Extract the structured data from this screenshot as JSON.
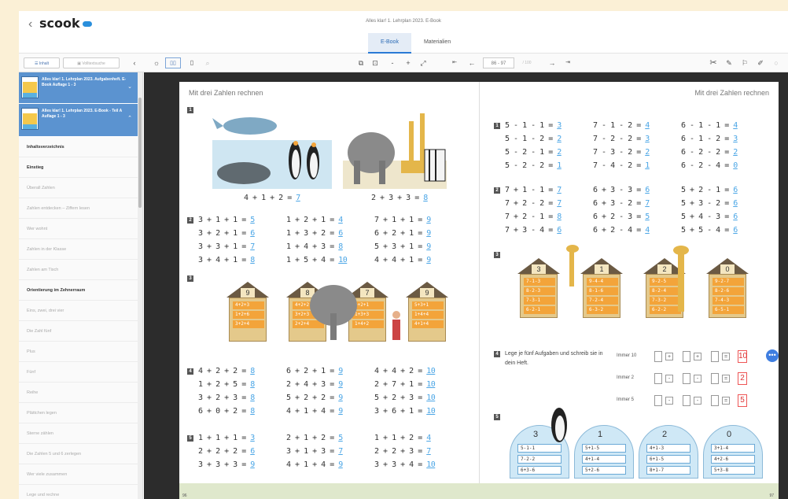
{
  "header": {
    "back_glyph": "‹",
    "logo": "scook",
    "doc_title": "Alles klar! 1. Lehrplan 2023. E-Book",
    "tabs": [
      {
        "label": "E-Book",
        "active": true
      },
      {
        "label": "Materialien",
        "active": false
      }
    ]
  },
  "toolbar": {
    "inhalt_label": "Inhalt",
    "search_label": "Volltextsuche",
    "collapse_glyph": "‹",
    "page_range": "86 - 97",
    "page_total": "/ 100",
    "zoom_minus": "-",
    "zoom_plus": "+",
    "icons": [
      "idea-icon",
      "double-page-icon",
      "single-page-icon",
      "search-icon",
      "gallery-icon",
      "fit-icon",
      "expand-icon",
      "first-page-icon",
      "prev-page-icon",
      "next-page-icon",
      "last-page-icon",
      "tools-icon",
      "notes-icon",
      "bookmark-icon",
      "pen-icon"
    ]
  },
  "sidebar": {
    "books": [
      {
        "text": "Alles klar! 1. Lehrplan 2023. Aufgabenheft. E-Book Auflage 1 - 3"
      },
      {
        "text": "Alles klar! 1. Lehrplan 2023. E-Book - Teil A Auflage 1 - 3"
      }
    ],
    "items": [
      {
        "label": "Inhaltsverzeichnis",
        "head": true
      },
      {
        "label": "Einstieg",
        "head": true
      },
      {
        "label": "Überall Zahlen",
        "head": false
      },
      {
        "label": "Zahlen entdecken – Ziffern lesen",
        "head": false
      },
      {
        "label": "Wer wohnt",
        "head": false
      },
      {
        "label": "Zahlen in der Klasse",
        "head": false
      },
      {
        "label": "Zahlen am Tisch",
        "head": false
      },
      {
        "label": "Orientierung im Zehnerraum",
        "head": true
      },
      {
        "label": "Eins, zwei, drei vier",
        "head": false
      },
      {
        "label": "Die Zahl fünf",
        "head": false
      },
      {
        "label": "Plus",
        "head": false
      },
      {
        "label": "Fünf",
        "head": false
      },
      {
        "label": "Reihe",
        "head": false
      },
      {
        "label": "Plättchen legen",
        "head": false
      },
      {
        "label": "Sterne zählen",
        "head": false
      },
      {
        "label": "Die Zahlen 5 und 6 zerlegen",
        "head": false
      },
      {
        "label": "Wer viele zusammen",
        "head": false
      },
      {
        "label": "Lege und rechne",
        "head": false
      }
    ]
  },
  "page_left": {
    "title": "Mit drei Zahlen rechnen",
    "page_no": "96",
    "task1": [
      {
        "eq": "4 + 1 + 2 = ",
        "ans": "7"
      },
      {
        "eq": "2 + 3 + 3 = ",
        "ans": "8"
      }
    ],
    "task2": [
      [
        {
          "eq": "3 + 1 + 1 = ",
          "ans": "5"
        },
        {
          "eq": "1 + 2 + 1 = ",
          "ans": "4"
        },
        {
          "eq": "7 + 1 + 1 = ",
          "ans": "9"
        }
      ],
      [
        {
          "eq": "3 + 2 + 1 = ",
          "ans": "6"
        },
        {
          "eq": "1 + 3 + 2 = ",
          "ans": "6"
        },
        {
          "eq": "6 + 2 + 1 = ",
          "ans": "9"
        }
      ],
      [
        {
          "eq": "3 + 3 + 1 = ",
          "ans": "7"
        },
        {
          "eq": "1 + 4 + 3 = ",
          "ans": "8"
        },
        {
          "eq": "5 + 3 + 1 = ",
          "ans": "9"
        }
      ],
      [
        {
          "eq": "3 + 4 + 1 = ",
          "ans": "8"
        },
        {
          "eq": "1 + 5 + 4 = ",
          "ans": "10"
        },
        {
          "eq": "4 + 4 + 1 = ",
          "ans": "9"
        }
      ]
    ],
    "houses": [
      {
        "num": "9",
        "rows": [
          "4+2+3",
          "1+2+6",
          "3+2+4"
        ]
      },
      {
        "num": "8",
        "rows": [
          "4+2+2",
          "3+2+3",
          "2+2+4"
        ]
      },
      {
        "num": "7",
        "rows": [
          "4+2+1",
          "1+3+3",
          "1+4+2"
        ]
      },
      {
        "num": "9",
        "rows": [
          "5+3+1",
          "1+4+4",
          "4+1+4"
        ]
      }
    ],
    "task4": [
      [
        {
          "eq": "4 + 2 + 2 = ",
          "ans": "8"
        },
        {
          "eq": "6 + 2 + 1 = ",
          "ans": "9"
        },
        {
          "eq": "4 + 4 + 2 = ",
          "ans": "10"
        }
      ],
      [
        {
          "eq": "1 + 2 + 5 = ",
          "ans": "8"
        },
        {
          "eq": "2 + 4 + 3 = ",
          "ans": "9"
        },
        {
          "eq": "2 + 7 + 1 = ",
          "ans": "10"
        }
      ],
      [
        {
          "eq": "3 + 2 + 3 = ",
          "ans": "8"
        },
        {
          "eq": "5 + 2 + 2 = ",
          "ans": "9"
        },
        {
          "eq": "5 + 2 + 3 = ",
          "ans": "10"
        }
      ],
      [
        {
          "eq": "6 + 0 + 2 = ",
          "ans": "8"
        },
        {
          "eq": "4 + 1 + 4 = ",
          "ans": "9"
        },
        {
          "eq": "3 + 6 + 1 = ",
          "ans": "10"
        }
      ]
    ],
    "task5": [
      [
        {
          "eq": "1 + 1 + 1 = ",
          "ans": "3"
        },
        {
          "eq": "2 + 1 + 2 = ",
          "ans": "5"
        },
        {
          "eq": "1 + 1 + 2 = ",
          "ans": "4"
        }
      ],
      [
        {
          "eq": "2 + 2 + 2 = ",
          "ans": "6"
        },
        {
          "eq": "3 + 1 + 3 = ",
          "ans": "7"
        },
        {
          "eq": "2 + 2 + 3 = ",
          "ans": "7"
        }
      ],
      [
        {
          "eq": "3 + 3 + 3 = ",
          "ans": "9"
        },
        {
          "eq": "4 + 1 + 4 = ",
          "ans": "9"
        },
        {
          "eq": "3 + 3 + 4 = ",
          "ans": "10"
        }
      ]
    ]
  },
  "page_right": {
    "title": "Mit drei Zahlen rechnen",
    "page_no": "97",
    "task1": [
      [
        {
          "eq": "5 - 1 - 1 = ",
          "ans": "3"
        },
        {
          "eq": "7 - 1 - 2 = ",
          "ans": "4"
        },
        {
          "eq": "6 - 1 - 1 = ",
          "ans": "4"
        }
      ],
      [
        {
          "eq": "5 - 1 - 2 = ",
          "ans": "2"
        },
        {
          "eq": "7 - 2 - 2 = ",
          "ans": "3"
        },
        {
          "eq": "6 - 1 - 2 = ",
          "ans": "3"
        }
      ],
      [
        {
          "eq": "5 - 2 - 1 = ",
          "ans": "2"
        },
        {
          "eq": "7 - 3 - 2 = ",
          "ans": "2"
        },
        {
          "eq": "6 - 2 - 2 = ",
          "ans": "2"
        }
      ],
      [
        {
          "eq": "5 - 2 - 2 = ",
          "ans": "1"
        },
        {
          "eq": "7 - 4 - 2 = ",
          "ans": "1"
        },
        {
          "eq": "6 - 2 - 4 = ",
          "ans": "0"
        }
      ]
    ],
    "task2": [
      [
        {
          "eq": "7 + 1 - 1 = ",
          "ans": "7"
        },
        {
          "eq": "6 + 3 - 3 = ",
          "ans": "6"
        },
        {
          "eq": "5 + 2 - 1 = ",
          "ans": "6"
        }
      ],
      [
        {
          "eq": "7 + 2 - 2 = ",
          "ans": "7"
        },
        {
          "eq": "6 + 3 - 2 = ",
          "ans": "7"
        },
        {
          "eq": "5 + 3 - 2 = ",
          "ans": "6"
        }
      ],
      [
        {
          "eq": "7 + 2 - 1 = ",
          "ans": "8"
        },
        {
          "eq": "6 + 2 - 3 = ",
          "ans": "5"
        },
        {
          "eq": "5 + 4 - 3 = ",
          "ans": "6"
        }
      ],
      [
        {
          "eq": "7 + 3 - 4 = ",
          "ans": "6"
        },
        {
          "eq": "6 + 2 - 4 = ",
          "ans": "4"
        },
        {
          "eq": "5 + 5 - 4 = ",
          "ans": "6"
        }
      ]
    ],
    "houses": [
      {
        "num": "3",
        "rows": [
          "7-1-3",
          "8-2-3",
          "7-3-1",
          "6-2-1"
        ]
      },
      {
        "num": "1",
        "rows": [
          "9-4-4",
          "8-1-6",
          "7-2-4",
          "6-3-2"
        ]
      },
      {
        "num": "2",
        "rows": [
          "9-2-5",
          "8-2-4",
          "7-3-2",
          "6-2-2"
        ]
      },
      {
        "num": "0",
        "rows": [
          "9-2-7",
          "8-2-6",
          "7-4-3",
          "6-5-1"
        ]
      }
    ],
    "task4_text": "Lege je fünf Aufgaben und schreib sie in dein Heft.",
    "task4_rows": [
      {
        "label": "Immer 10",
        "result": "10"
      },
      {
        "label": "Immer 2",
        "result": "2"
      },
      {
        "label": "Immer 5",
        "result": "5"
      }
    ],
    "iglus": [
      {
        "num": "3",
        "rows": [
          "5-1-1",
          "7-2-2",
          "6+3-6"
        ]
      },
      {
        "num": "1",
        "rows": [
          "5+1-5",
          "4+1-4",
          "5+2-6"
        ]
      },
      {
        "num": "2",
        "rows": [
          "4+1-3",
          "6+1-5",
          "8+1-7"
        ]
      },
      {
        "num": "0",
        "rows": [
          "3+1-4",
          "4+2-6",
          "5+3-8"
        ]
      }
    ]
  },
  "fab_label": "•••"
}
